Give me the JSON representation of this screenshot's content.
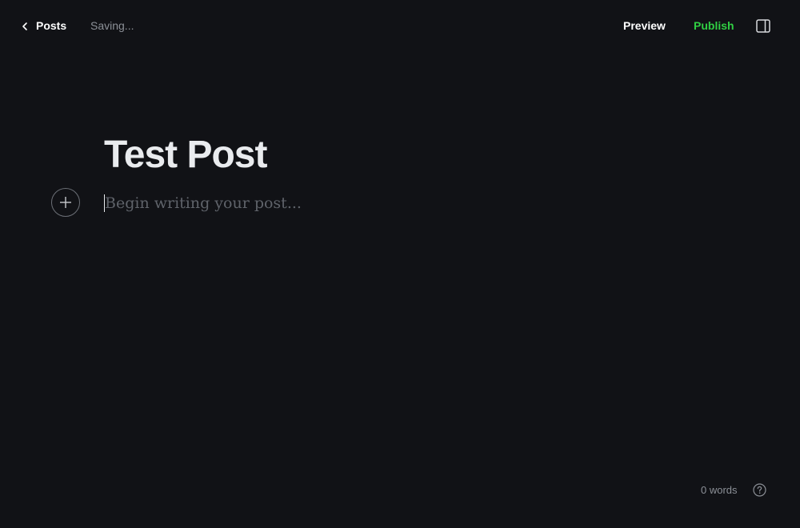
{
  "topbar": {
    "back_label": "Posts",
    "status": "Saving...",
    "preview_label": "Preview",
    "publish_label": "Publish"
  },
  "editor": {
    "title": "Test Post",
    "body_placeholder": "Begin writing your post..."
  },
  "footer": {
    "word_count": "0 words"
  },
  "colors": {
    "background": "#111216",
    "publish": "#30cf43",
    "muted": "#8c9097"
  },
  "icons": [
    "chevron-left-icon",
    "sidebar-toggle-icon",
    "plus-icon",
    "help-icon"
  ]
}
